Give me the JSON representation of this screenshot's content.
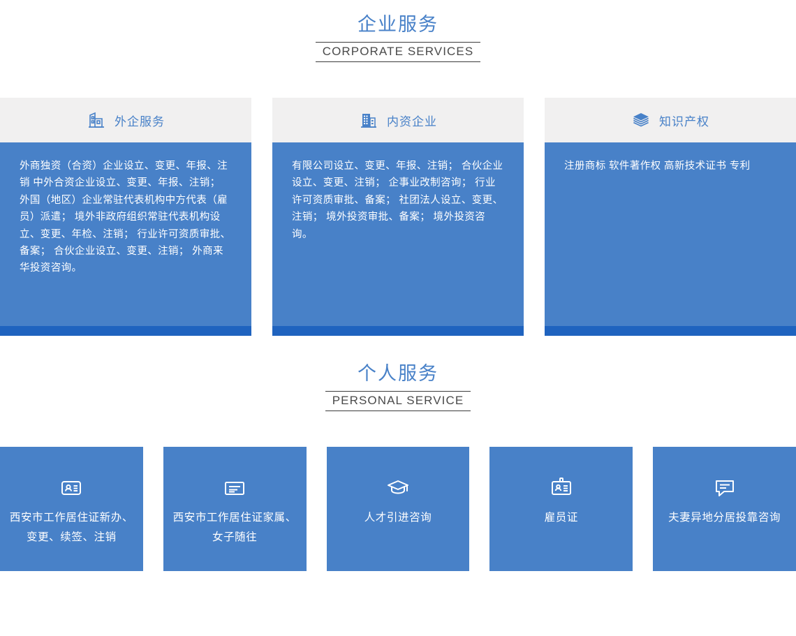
{
  "corporate": {
    "heading_cn": "企业服务",
    "heading_en": "CORPORATE SERVICES",
    "cards": [
      {
        "id": "foreign",
        "icon": "office-building-icon",
        "title": "外企服务",
        "lines": "外商独资（合资）企业设立、变更、年报、注销\n中外合资企业设立、变更、年报、注销；\n外国（地区）企业常驻代表机构中方代表（雇员）派遣；\n境外非政府组织常驻代表机构设立、变更、年检、注销；\n行业许可资质审批、备案；\n合伙企业设立、变更、注销；\n外商来华投资咨询。"
      },
      {
        "id": "domestic",
        "icon": "city-building-icon",
        "title": "内资企业",
        "lines": "有限公司设立、变更、年报、注销；\n合伙企业设立、变更、注销；\n企事业改制咨询；\n行业许可资质审批、备案；\n社团法人设立、变更、注销；\n境外投资审批、备案；\n境外投资咨询。"
      },
      {
        "id": "ip",
        "icon": "layers-stack-icon",
        "title": "知识产权",
        "lines": "注册商标\n软件著作权\n高新技术证书\n专利"
      }
    ]
  },
  "personal": {
    "heading_cn": "个人服务",
    "heading_en": "PERSONAL SERVICE",
    "tiles": [
      {
        "id": "residence-permit",
        "icon": "id-card-person-icon",
        "label": "西安市工作居住证新办、变更、续签、注销"
      },
      {
        "id": "family-residence",
        "icon": "document-lines-icon",
        "label": "西安市工作居住证家属、女子随往"
      },
      {
        "id": "talent-intro",
        "icon": "graduation-cap-icon",
        "label": "人才引进咨询"
      },
      {
        "id": "employee-card",
        "icon": "badge-id-icon",
        "label": "雇员证"
      },
      {
        "id": "spouse-relocation",
        "icon": "chat-bubble-icon",
        "label": "夫妻异地分居投靠咨询"
      }
    ]
  },
  "colors": {
    "brand_blue": "#4881c8",
    "dark_blue_bar": "#1f63bf",
    "header_gray": "#f1f0f0",
    "heading_text": "#4881c8",
    "subtitle_text": "#4a4a4a"
  }
}
